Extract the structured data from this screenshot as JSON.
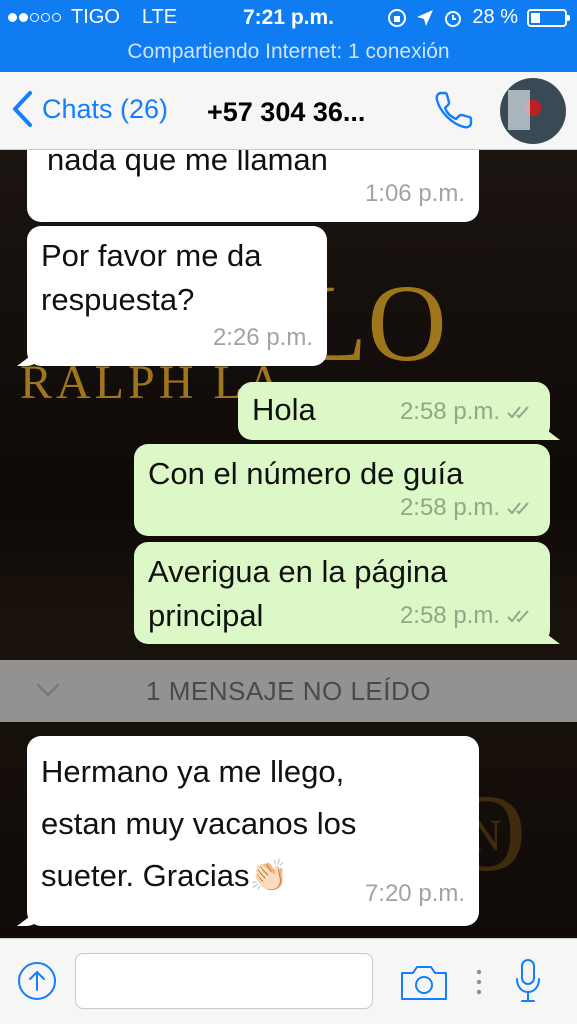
{
  "status_bar": {
    "carrier": "TIGO",
    "network": "LTE",
    "time": "7:21 p.m.",
    "battery_percent": "28 %",
    "battery_level": 0.28,
    "hotspot": "Compartiendo Internet: 1 conexión"
  },
  "nav": {
    "back_label": "Chats (26)",
    "contact": "+57 304 36..."
  },
  "messages": [
    {
      "dir": "in",
      "text": "nada que me llaman",
      "time": "1:06 p.m."
    },
    {
      "dir": "in",
      "text": "Por favor me da respuesta?",
      "time": "2:26 p.m."
    },
    {
      "dir": "out",
      "text": "Hola",
      "time": "2:58 p.m."
    },
    {
      "dir": "out",
      "text": "Con el número de guía",
      "time": "2:58 p.m."
    },
    {
      "dir": "out",
      "text": "Averigua en la página principal",
      "time": "2:58 p.m."
    },
    {
      "dir": "in",
      "text": "Hermano ya me llego, estan muy vacanos los sueter. Gracias👏🏻",
      "time": "7:20 p.m."
    }
  ],
  "unread_banner": "1 MENSAJE NO LEÍDO",
  "background_text": [
    "LO",
    "RALPH LA",
    "OLO",
    "N"
  ],
  "colors": {
    "status_bar": "#0f7cf2",
    "accent": "#147efb",
    "outgoing_bubble": "#dcf8c6",
    "incoming_bubble": "#ffffff"
  }
}
